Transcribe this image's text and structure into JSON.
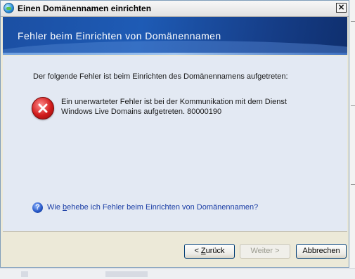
{
  "window": {
    "title": "Einen Domänennamen einrichten",
    "close_glyph": "×"
  },
  "banner": {
    "title": "Fehler beim Einrichten von Domänennamen"
  },
  "content": {
    "intro": "Der folgende Fehler ist beim Einrichten des Domänennamens aufgetreten:",
    "error_line1": "Ein unerwarteter Fehler ist bei der Kommunikation mit dem Dienst",
    "error_line2": "Windows Live Domains aufgetreten. 80000190",
    "help_pre": "Wie ",
    "help_ul": "b",
    "help_post": "ehebe ich Fehler beim Einrichten von Domänennamen?",
    "help_icon_glyph": "?"
  },
  "buttons": {
    "back_pre": "< ",
    "back_ul": "Z",
    "back_post": "urück",
    "next": "Weiter >",
    "cancel": "Abbrechen"
  },
  "icons": {
    "title": "globe-icon",
    "error": "error-x-icon",
    "help": "help-question-icon"
  },
  "colors": {
    "banner": "#1b4fa3",
    "content_bg": "#e3e9f3",
    "link": "#1c3fa6",
    "error_red": "#d11c1c"
  }
}
